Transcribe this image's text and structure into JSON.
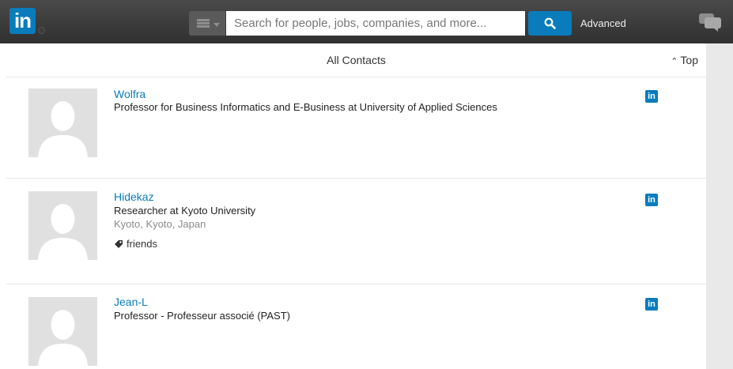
{
  "nav": {
    "logo_text": "in",
    "search_placeholder": "Search for people, jobs, companies, and more...",
    "advanced_label": "Advanced",
    "brand_color": "#0a7cbc"
  },
  "panel": {
    "title": "All Contacts",
    "top_link": "Top"
  },
  "contacts": [
    {
      "name": "Wolfra",
      "headline": "Professor for Business Informatics and E-Business at University of Applied Sciences",
      "location": "",
      "tag": "",
      "badge": "in"
    },
    {
      "name": "Hidekaz",
      "headline": "Researcher at Kyoto University",
      "location": "Kyoto, Kyoto, Japan",
      "tag": "friends",
      "badge": "in"
    },
    {
      "name": "Jean-L",
      "headline": "Professor - Professeur associé (PAST)",
      "location": "",
      "tag": "",
      "badge": "in"
    }
  ]
}
